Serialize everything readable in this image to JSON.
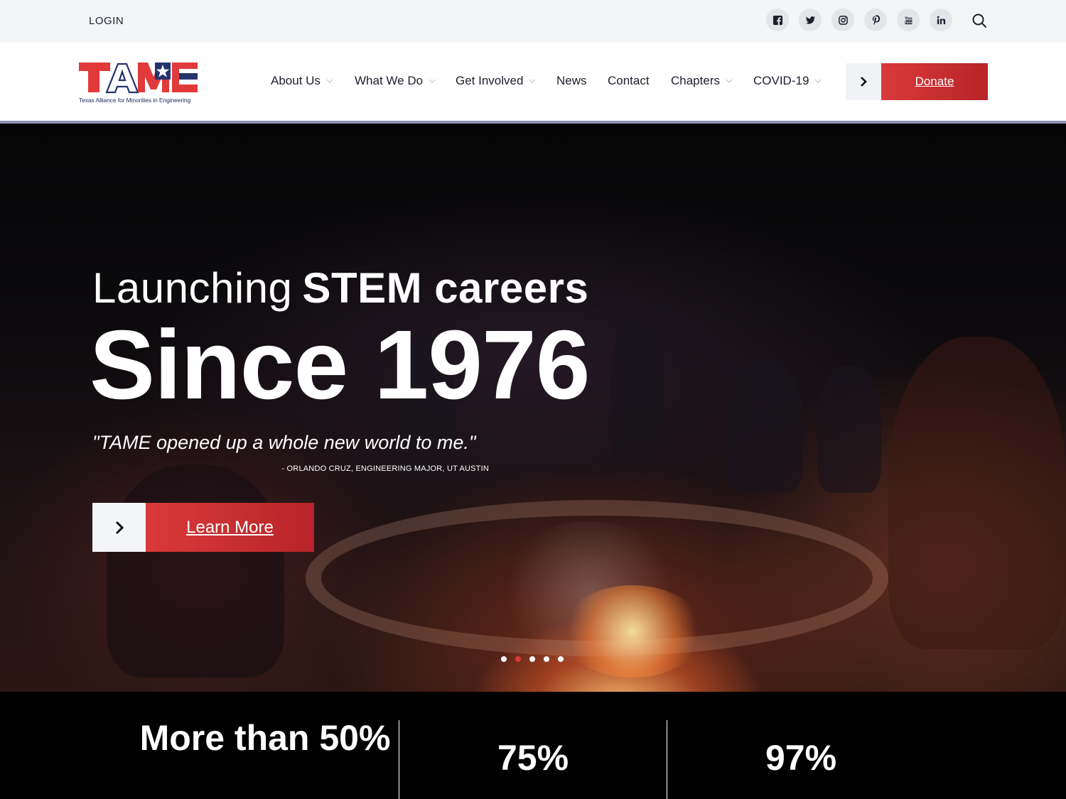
{
  "topbar": {
    "login_label": "LOGIN",
    "social": [
      {
        "name": "facebook-icon"
      },
      {
        "name": "twitter-icon"
      },
      {
        "name": "instagram-icon"
      },
      {
        "name": "pinterest-icon"
      },
      {
        "name": "youtube-icon"
      },
      {
        "name": "linkedin-icon"
      }
    ]
  },
  "logo": {
    "text": "TAME",
    "tagline": "Texas Alliance for Minorities in Engineering",
    "colors": {
      "red": "#e03a3a",
      "blue": "#25336b"
    }
  },
  "nav": {
    "items": [
      {
        "label": "About Us",
        "has_dropdown": true
      },
      {
        "label": "What We Do",
        "has_dropdown": true
      },
      {
        "label": "Get Involved",
        "has_dropdown": true
      },
      {
        "label": "News",
        "has_dropdown": false
      },
      {
        "label": "Contact",
        "has_dropdown": false
      },
      {
        "label": "Chapters",
        "has_dropdown": true
      },
      {
        "label": "COVID-19",
        "has_dropdown": true
      }
    ],
    "donate_label": "Donate"
  },
  "hero": {
    "line1_light": "Launching",
    "line1_bold": "STEM careers",
    "line2": "Since 1976",
    "quote": "\"TAME opened up a whole new world to me.\"",
    "attribution": "- ORLANDO CRUZ, ENGINEERING MAJOR, UT AUSTIN",
    "cta_label": "Learn More",
    "slides": {
      "count": 5,
      "active_index": 1
    }
  },
  "stats": [
    {
      "value": "More than 50%"
    },
    {
      "value": "75%"
    },
    {
      "value": "97%"
    }
  ],
  "colors": {
    "accent_red": "#d93a3a",
    "topbar_bg": "#f4f5f7",
    "header_rule": "#8e92b5"
  }
}
